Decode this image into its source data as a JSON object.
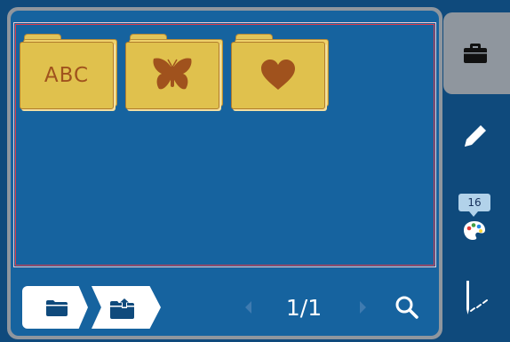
{
  "folders": [
    {
      "icon": "abc-text",
      "label": "ABC"
    },
    {
      "icon": "butterfly-icon"
    },
    {
      "icon": "heart-icon"
    }
  ],
  "pager": {
    "text": "1/1"
  },
  "side": {
    "badge_count": "16",
    "active_tab": "folder"
  },
  "bottom": {
    "open_folder_icon": "folder-icon",
    "export_icon": "folder-upload-icon"
  },
  "colors": {
    "background": "#0f4a7c",
    "panel": "#16639f",
    "folder": "#e0c14d",
    "folder_mark": "#a0521d"
  }
}
